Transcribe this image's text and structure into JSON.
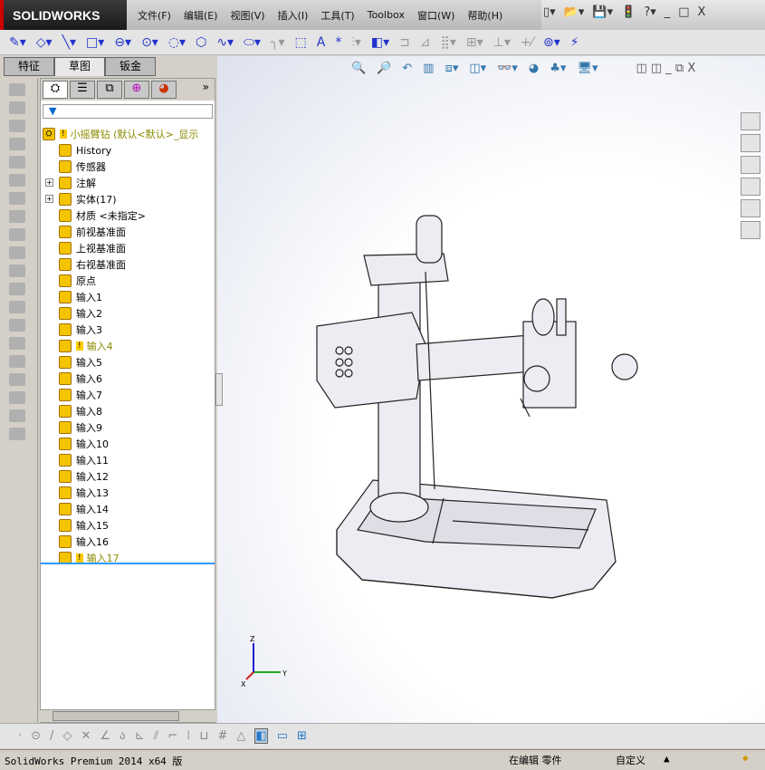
{
  "app": {
    "logo": "SOLIDWORKS"
  },
  "menu": [
    "文件(F)",
    "编辑(E)",
    "视图(V)",
    "插入(I)",
    "工具(T)",
    "Toolbox",
    "窗口(W)",
    "帮助(H)"
  ],
  "tabs": [
    {
      "label": "特征",
      "active": false
    },
    {
      "label": "草图",
      "active": true
    },
    {
      "label": "钣金",
      "active": false
    }
  ],
  "tree": {
    "root": "小摇臂钻  (默认<默认>_显示",
    "items": [
      {
        "label": "History",
        "icon": "history-icon",
        "expand": false
      },
      {
        "label": "传感器",
        "icon": "sensor-icon",
        "expand": false
      },
      {
        "label": "注解",
        "icon": "annotation-icon",
        "expand": true
      },
      {
        "label": "实体(17)",
        "icon": "solid-bodies-icon",
        "expand": true
      },
      {
        "label": "材质 <未指定>",
        "icon": "material-icon",
        "expand": false
      },
      {
        "label": "前视基准面",
        "icon": "plane-icon",
        "expand": false
      },
      {
        "label": "上视基准面",
        "icon": "plane-icon",
        "expand": false
      },
      {
        "label": "右视基准面",
        "icon": "plane-icon",
        "expand": false
      },
      {
        "label": "原点",
        "icon": "origin-icon",
        "expand": false
      },
      {
        "label": "输入1"
      },
      {
        "label": "输入2"
      },
      {
        "label": "输入3"
      },
      {
        "label": "输入4",
        "warning": true
      },
      {
        "label": "输入5"
      },
      {
        "label": "输入6"
      },
      {
        "label": "输入7"
      },
      {
        "label": "输入8"
      },
      {
        "label": "输入9"
      },
      {
        "label": "输入10"
      },
      {
        "label": "输入11"
      },
      {
        "label": "输入12"
      },
      {
        "label": "输入13"
      },
      {
        "label": "输入14"
      },
      {
        "label": "输入15"
      },
      {
        "label": "输入16"
      },
      {
        "label": "输入17",
        "warning": true
      }
    ]
  },
  "status": {
    "version": "SolidWorks Premium 2014 x64 版",
    "mode": "在编辑 零件",
    "units": "自定义"
  },
  "triad": {
    "x": "Y",
    "y": "Z",
    "z": "X"
  }
}
